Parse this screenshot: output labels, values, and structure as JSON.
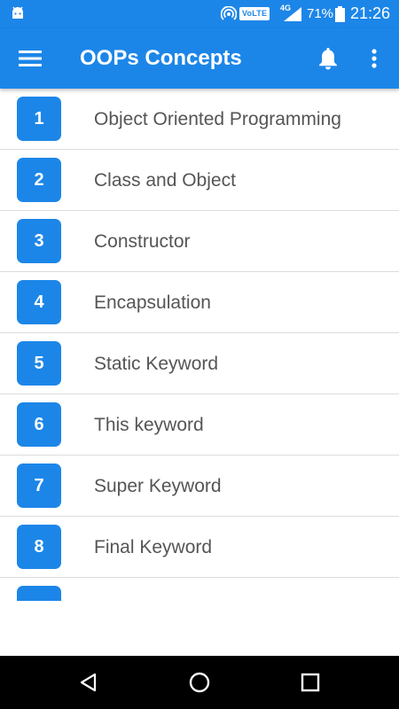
{
  "status_bar": {
    "volte": "VoLTE",
    "network": "4G",
    "battery": "71%",
    "time": "21:26",
    "icons": [
      "android-icon",
      "hotspot-icon",
      "signal-icon",
      "battery-icon"
    ]
  },
  "app_bar": {
    "title": "OOPs Concepts",
    "icons": [
      "hamburger-menu-icon",
      "bell-icon",
      "more-vert-icon"
    ]
  },
  "topics": [
    {
      "num": "1",
      "label": "Object Oriented Programming"
    },
    {
      "num": "2",
      "label": "Class and Object"
    },
    {
      "num": "3",
      "label": "Constructor"
    },
    {
      "num": "4",
      "label": "Encapsulation"
    },
    {
      "num": "5",
      "label": "Static Keyword"
    },
    {
      "num": "6",
      "label": "This keyword"
    },
    {
      "num": "7",
      "label": "Super Keyword"
    },
    {
      "num": "8",
      "label": "Final Keyword"
    }
  ],
  "nav_bar": {
    "icons": [
      "back-icon",
      "home-icon",
      "recents-icon"
    ]
  },
  "colors": {
    "primary": "#1c86e8",
    "text": "#555555",
    "divider": "#dcdcdc"
  }
}
